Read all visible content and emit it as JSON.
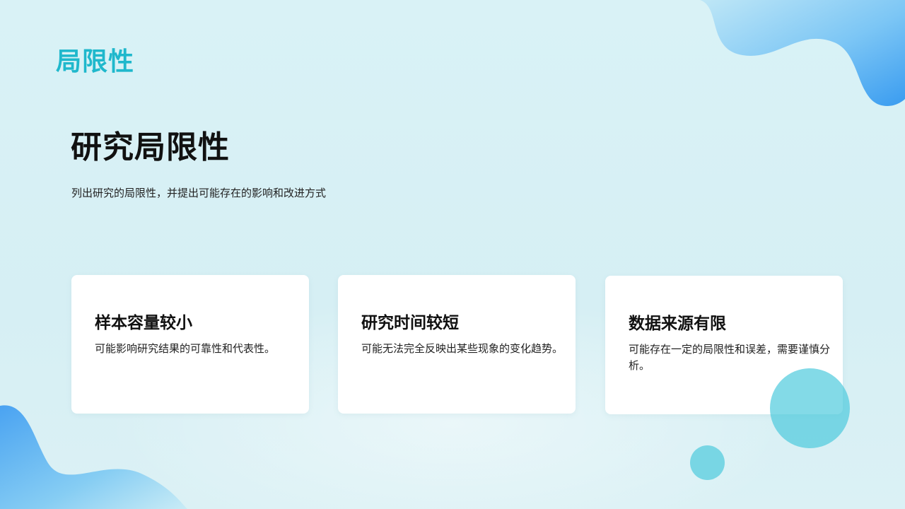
{
  "slide": {
    "section_label": "局限性",
    "title": "研究局限性",
    "subtitle": "列出研究的局限性，并提出可能存在的影响和改进方式"
  },
  "cards": [
    {
      "title": "样本容量较小",
      "text": "可能影响研究结果的可靠性和代表性。"
    },
    {
      "title": "研究时间较短",
      "text": "可能无法完全反映出某些现象的变化趋势。"
    },
    {
      "title": "数据来源有限",
      "text": "可能存在一定的局限性和误差，需要谨慎分析。"
    }
  ],
  "colors": {
    "accent": "#1fb8cc",
    "background": "#d8f1f5",
    "blob_blue": "#3a9cf0",
    "circle": "#48c8dc"
  }
}
